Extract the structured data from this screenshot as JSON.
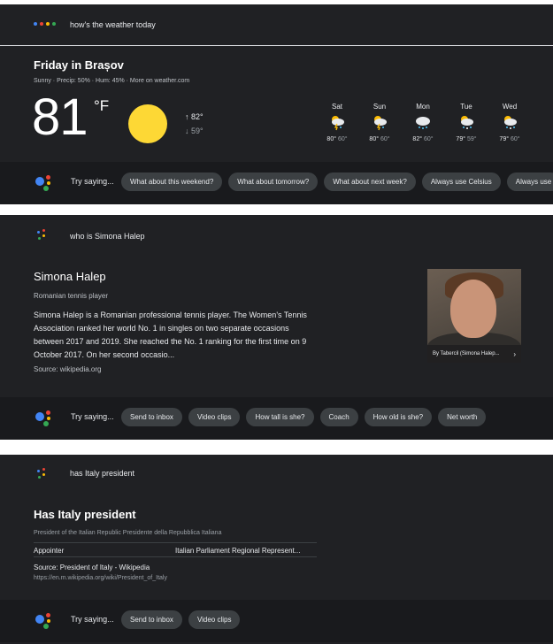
{
  "colors": {
    "panel_bg": "#202124",
    "try_bar_bg": "#191a1d",
    "chip_bg": "#3c4043",
    "google_blue": "#4285f4",
    "google_red": "#ea4335",
    "google_yellow": "#fbbc05",
    "google_green": "#34a853",
    "sun": "#fdd835"
  },
  "weather": {
    "query": "how's the weather today",
    "title": "Friday in Brașov",
    "subtitle": "Sunny · Precip: 50% · Hum: 45% · More on weather.com",
    "temp": "81",
    "unit": "°F",
    "high": "↑ 82°",
    "low": "↓ 59°",
    "forecast": [
      {
        "day": "Sat",
        "hi": "80°",
        "lo": "60°",
        "icon": "thunderstorm-icon"
      },
      {
        "day": "Sun",
        "hi": "80°",
        "lo": "60°",
        "icon": "thunderstorm-icon"
      },
      {
        "day": "Mon",
        "hi": "82°",
        "lo": "60°",
        "icon": "rain-cloud-icon"
      },
      {
        "day": "Tue",
        "hi": "79°",
        "lo": "59°",
        "icon": "sleet-icon"
      },
      {
        "day": "Wed",
        "hi": "79°",
        "lo": "60°",
        "icon": "sleet-icon"
      }
    ],
    "try_label": "Try saying...",
    "chips": [
      "What about this weekend?",
      "What about tomorrow?",
      "What about next week?",
      "Always use Celsius",
      "Always use"
    ]
  },
  "halep": {
    "query": "who is Simona Halep",
    "title": "Simona Halep",
    "subtitle": "Romanian tennis player",
    "description": "Simona Halep is a Romanian professional tennis player. The Women's Tennis Association ranked her world No. 1 in singles on two separate occasions between 2017 and 2019. She reached the No. 1 ranking for the first time on 9 October 2017. On her second occasio...",
    "source": "Source: wikipedia.org",
    "photo_caption": "By Tabercil (Simona Halep...",
    "try_label": "Try saying...",
    "chips": [
      "Send to inbox",
      "Video clips",
      "How tall is she?",
      "Coach",
      "How old is she?",
      "Net worth"
    ]
  },
  "italy": {
    "query": "has Italy president",
    "title": "Has Italy president",
    "subtitle": "President of the Italian Republic Presidente della Repubblica Italiana",
    "row_key": "Appointer",
    "row_value": "Italian Parliament Regional Represent...",
    "source": "Source: President of Italy - Wikipedia",
    "url": "https://en.m.wikipedia.org/wiki/President_of_Italy",
    "try_label": "Try saying...",
    "chips": [
      "Send to inbox",
      "Video clips"
    ]
  }
}
